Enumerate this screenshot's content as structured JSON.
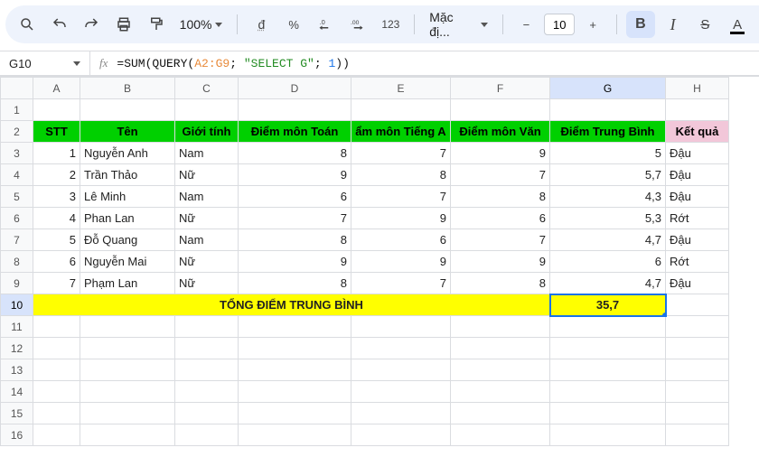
{
  "toolbar": {
    "zoom": "100%",
    "currency_btn": "đ",
    "percent_btn": "%",
    "inc_dec_label": ".0",
    "dec_inc_label": ".00",
    "fmt_123": "123",
    "font": "Mặc đị...",
    "minus": "−",
    "font_size": "10",
    "plus": "+",
    "bold": "B",
    "italic": "I",
    "strike": "S",
    "color": "A"
  },
  "cell_ref": "G10",
  "formula": {
    "prefix": "=SUM(QUERY(",
    "range": "A2:G9",
    "mid": "; ",
    "sql": "\"SELECT G\"",
    "mid2": "; ",
    "num": "1",
    "suffix": "))"
  },
  "col_labels": [
    "A",
    "B",
    "C",
    "D",
    "E",
    "F",
    "G",
    "H"
  ],
  "row_labels": [
    "1",
    "2",
    "3",
    "4",
    "5",
    "6",
    "7",
    "8",
    "9",
    "10",
    "11",
    "12",
    "13",
    "14",
    "15",
    "16"
  ],
  "headers": {
    "A": "STT",
    "B": "Tên",
    "C": "Giới tính",
    "D": "Điểm môn Toán",
    "E": "ẩm môn Tiếng A",
    "F": "Điểm môn Văn",
    "G": "Điểm Trung Bình",
    "H": "Kết quả"
  },
  "rows": [
    {
      "A": "1",
      "B": "Nguyễn Anh",
      "C": "Nam",
      "D": "8",
      "E": "7",
      "F": "9",
      "G": "5",
      "H": "Đậu"
    },
    {
      "A": "2",
      "B": "Trần Thảo",
      "C": "Nữ",
      "D": "9",
      "E": "8",
      "F": "7",
      "G": "5,7",
      "H": "Đậu"
    },
    {
      "A": "3",
      "B": "Lê Minh",
      "C": "Nam",
      "D": "6",
      "E": "7",
      "F": "8",
      "G": "4,3",
      "H": "Đậu"
    },
    {
      "A": "4",
      "B": "Phan Lan",
      "C": "Nữ",
      "D": "7",
      "E": "9",
      "F": "6",
      "G": "5,3",
      "H": "Rớt"
    },
    {
      "A": "5",
      "B": "Đỗ Quang",
      "C": "Nam",
      "D": "8",
      "E": "6",
      "F": "7",
      "G": "4,7",
      "H": "Đậu"
    },
    {
      "A": "6",
      "B": "Nguyễn Mai",
      "C": "Nữ",
      "D": "9",
      "E": "9",
      "F": "9",
      "G": "6",
      "H": "Rớt"
    },
    {
      "A": "7",
      "B": "Phạm Lan",
      "C": "Nữ",
      "D": "8",
      "E": "7",
      "F": "8",
      "G": "4,7",
      "H": "Đậu"
    }
  ],
  "total": {
    "label": "TỔNG ĐIỂM TRUNG BÌNH",
    "value": "35,7"
  }
}
